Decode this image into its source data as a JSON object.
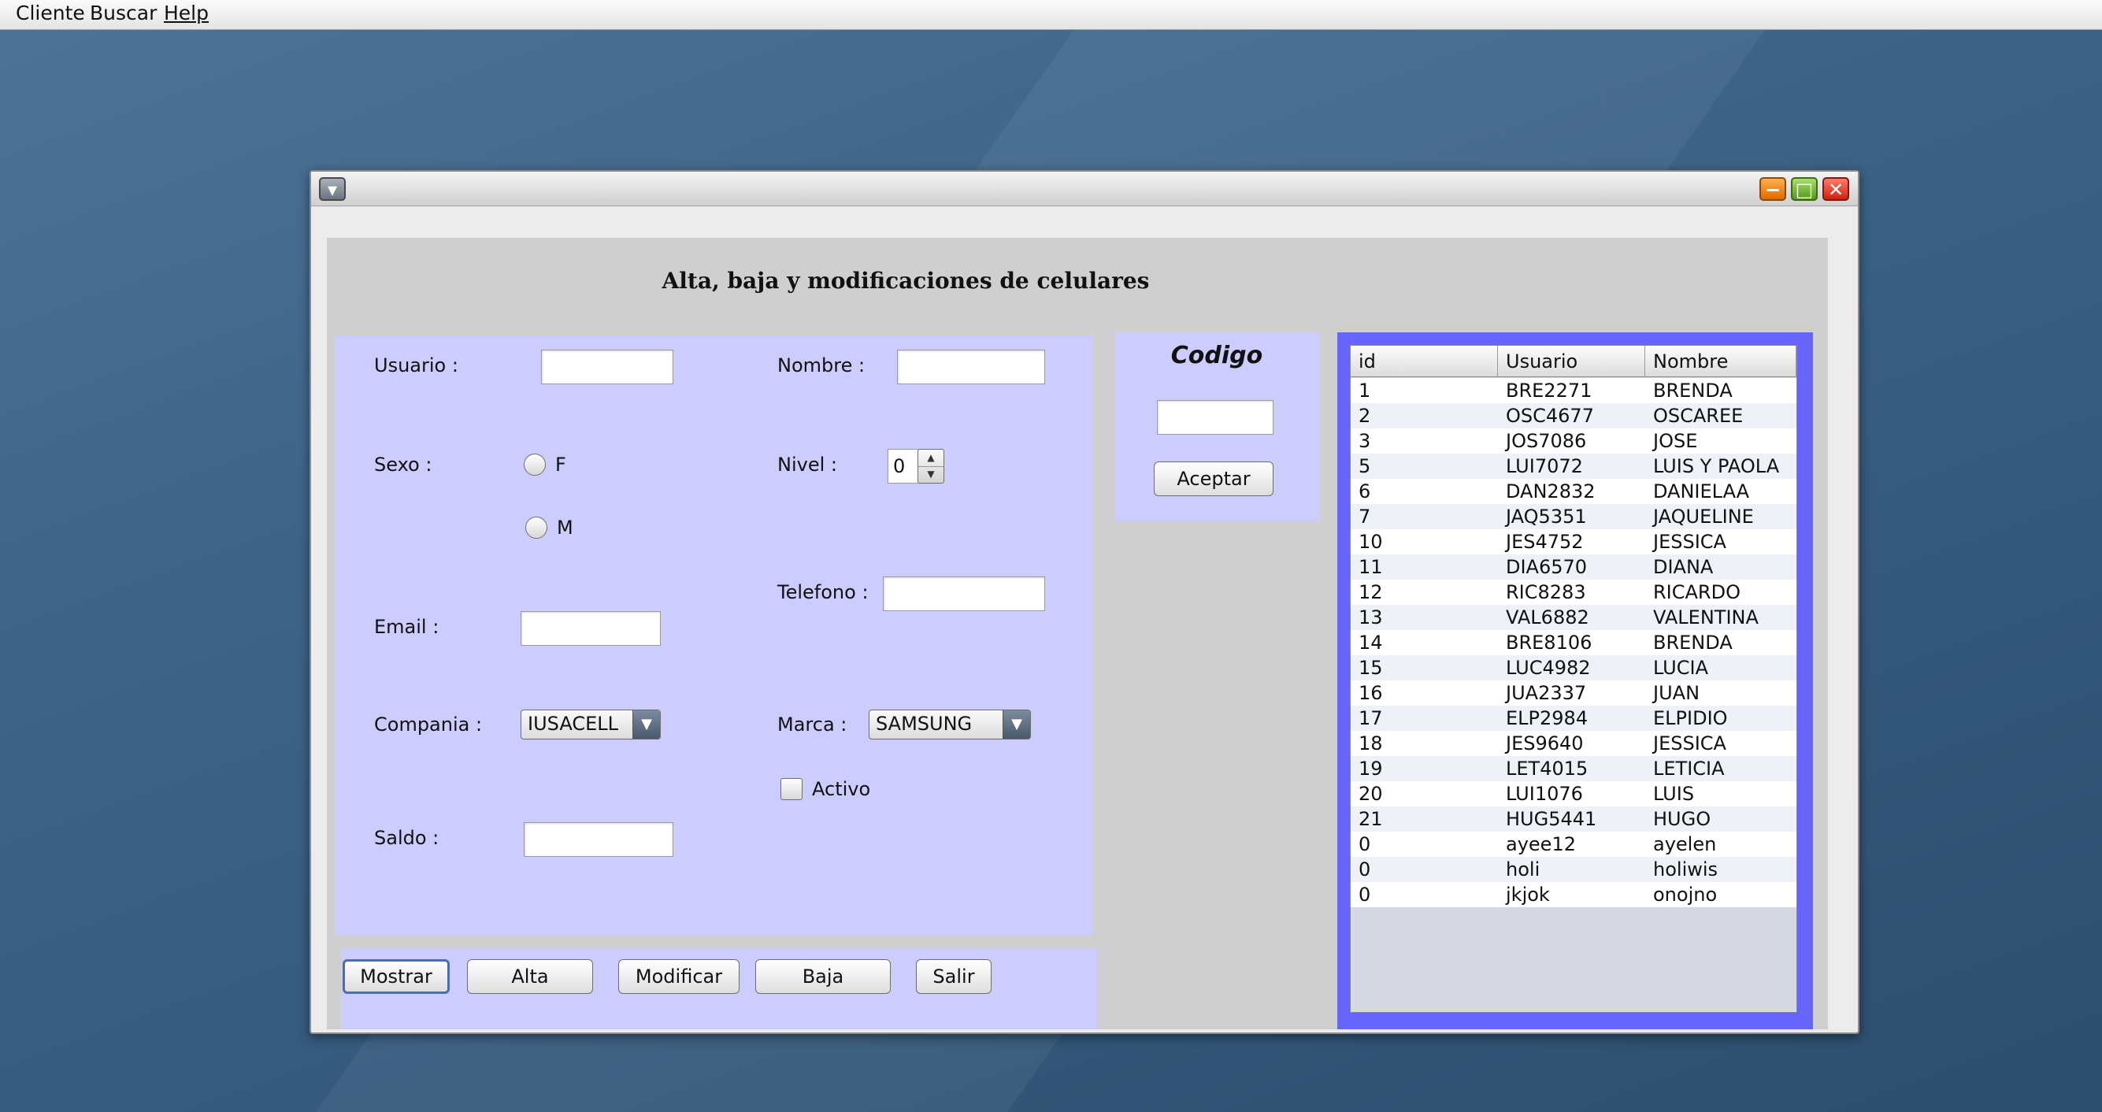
{
  "menubar": {
    "items": [
      {
        "label": "Cliente"
      },
      {
        "label": "Buscar"
      },
      {
        "label": "Help"
      }
    ]
  },
  "window": {
    "title": "",
    "controls": {
      "menu_icon": "chevron-down-icon",
      "minimize_icon": "minus-icon",
      "maximize_icon": "square-icon",
      "close_icon": "close-icon"
    }
  },
  "form": {
    "title": "Alta, baja y modificaciones de celulares",
    "usuario": {
      "label": "Usuario :",
      "value": ""
    },
    "nombre": {
      "label": "Nombre :",
      "value": ""
    },
    "sexo": {
      "label": "Sexo :",
      "options": [
        "F",
        "M"
      ],
      "selected": null
    },
    "nivel": {
      "label": "Nivel :",
      "value": "0"
    },
    "telefono": {
      "label": "Telefono :",
      "value": ""
    },
    "email": {
      "label": "Email :",
      "value": ""
    },
    "compania": {
      "label": "Compania :",
      "selected": "IUSACELL"
    },
    "marca": {
      "label": "Marca :",
      "selected": "SAMSUNG"
    },
    "activo": {
      "label": "Activo",
      "checked": false
    },
    "saldo": {
      "label": "Saldo :",
      "value": ""
    }
  },
  "buttons": {
    "mostrar": "Mostrar",
    "alta": "Alta",
    "modificar": "Modificar",
    "baja": "Baja",
    "salir": "Salir"
  },
  "codigo": {
    "title": "Codigo",
    "value": "",
    "button": "Aceptar"
  },
  "table": {
    "columns": [
      "id",
      "Usuario",
      "Nombre"
    ],
    "rows": [
      [
        "1",
        "BRE2271",
        "BRENDA"
      ],
      [
        "2",
        "OSC4677",
        "OSCAREE"
      ],
      [
        "3",
        "JOS7086",
        "JOSE"
      ],
      [
        "5",
        "LUI7072",
        "LUIS Y PAOLA"
      ],
      [
        "6",
        "DAN2832",
        "DANIELAA"
      ],
      [
        "7",
        "JAQ5351",
        "JAQUELINE"
      ],
      [
        "10",
        "JES4752",
        "JESSICA"
      ],
      [
        "11",
        "DIA6570",
        "DIANA"
      ],
      [
        "12",
        "RIC8283",
        "RICARDO"
      ],
      [
        "13",
        "VAL6882",
        "VALENTINA"
      ],
      [
        "14",
        "BRE8106",
        "BRENDA"
      ],
      [
        "15",
        "LUC4982",
        "LUCIA"
      ],
      [
        "16",
        "JUA2337",
        "JUAN"
      ],
      [
        "17",
        "ELP2984",
        "ELPIDIO"
      ],
      [
        "18",
        "JES9640",
        "JESSICA"
      ],
      [
        "19",
        "LET4015",
        "LETICIA"
      ],
      [
        "20",
        "LUI1076",
        "LUIS"
      ],
      [
        "21",
        "HUG5441",
        "HUGO"
      ],
      [
        "0",
        "ayee12",
        "ayelen"
      ],
      [
        "0",
        "holi",
        "holiwis"
      ],
      [
        "0",
        "jkjok",
        "onojno"
      ]
    ]
  },
  "colors": {
    "panel": "#ccccfe",
    "table_border": "#6666ff",
    "content_bg": "#cfcfcf"
  }
}
